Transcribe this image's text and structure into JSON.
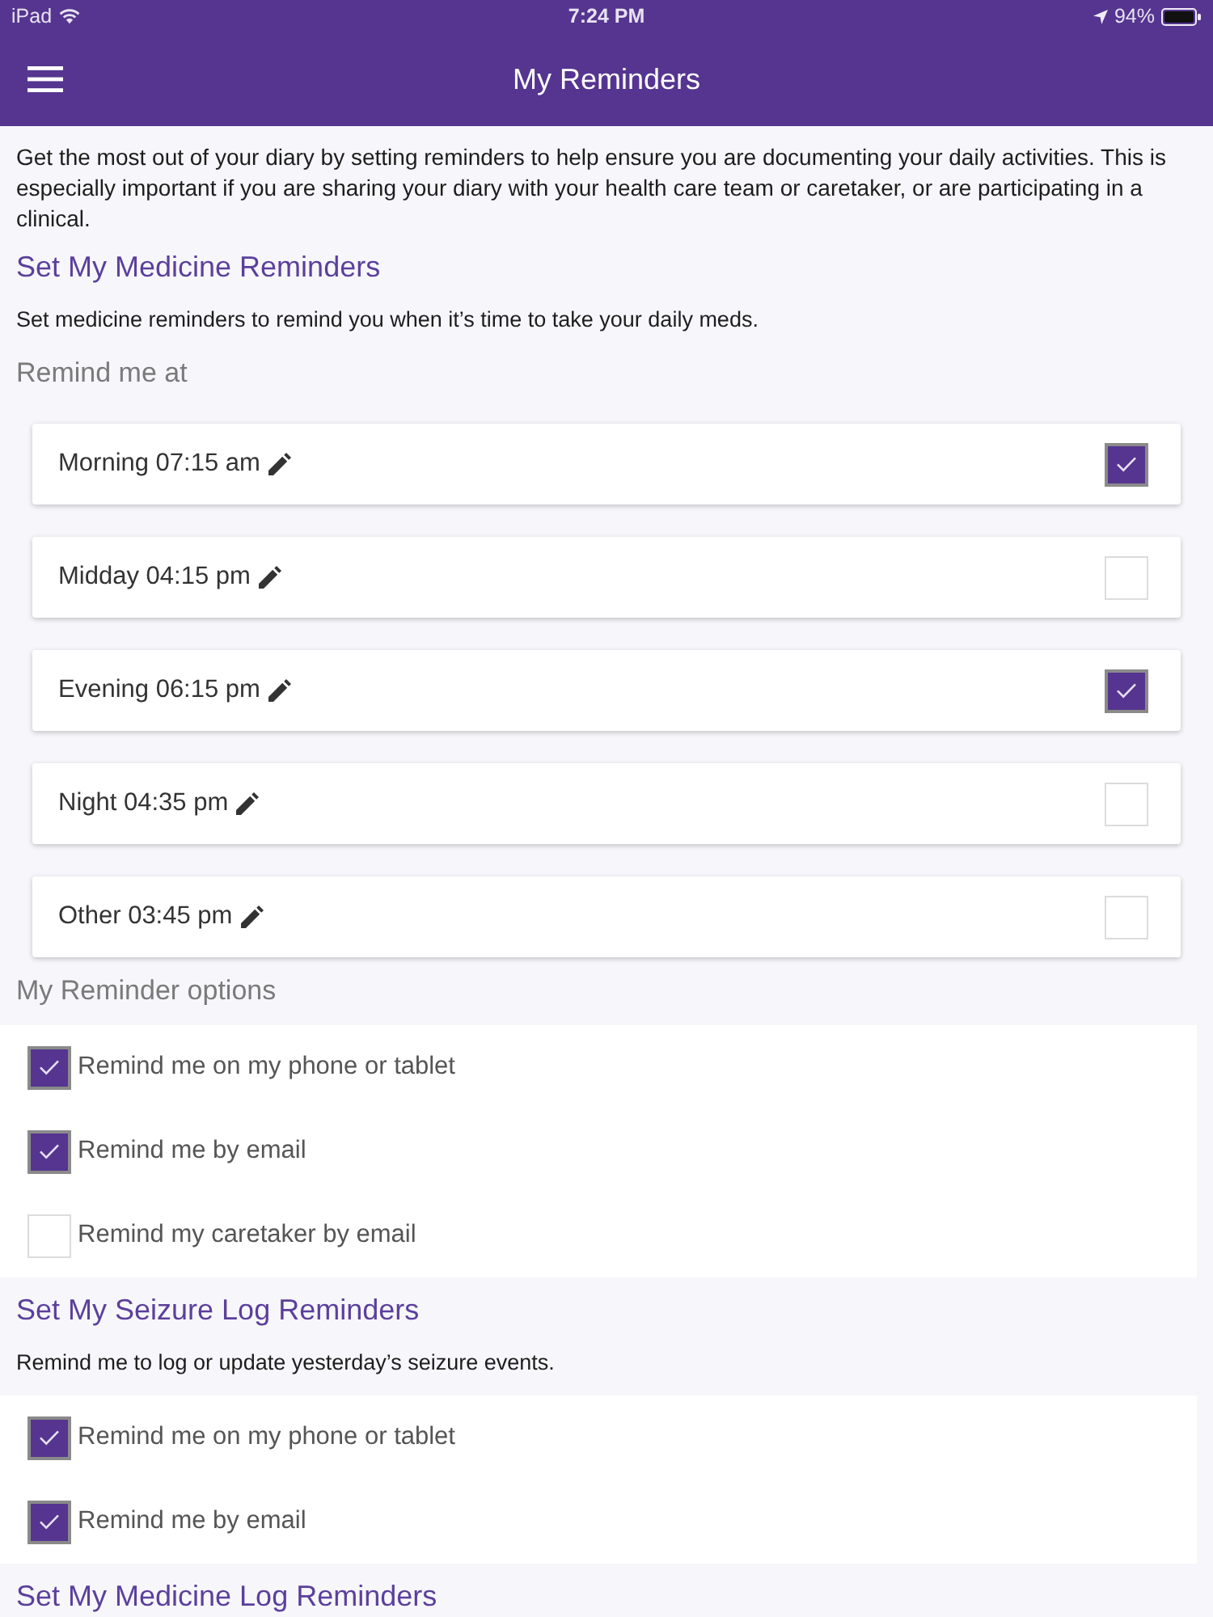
{
  "status_bar": {
    "device": "iPad",
    "time": "7:24 PM",
    "battery": "94%"
  },
  "app_bar": {
    "title": "My Reminders"
  },
  "intro": "Get the most out of your diary by setting reminders to help ensure you are documenting your daily activities. This is especially important if you are sharing your diary with your health care team or caretaker, or are participating in a clinical.",
  "sections": [
    {
      "heading": "Set My Medicine Reminders",
      "description": "Set medicine reminders to remind you when it’s time to take your daily meds.",
      "groups": [
        {
          "kind": "times",
          "label": "Remind me at",
          "items": [
            {
              "label": "Morning 07:15 am",
              "checked": true
            },
            {
              "label": "Midday 04:15 pm",
              "checked": false
            },
            {
              "label": "Evening 06:15 pm",
              "checked": true
            },
            {
              "label": "Night 04:35 pm",
              "checked": false
            },
            {
              "label": "Other 03:45 pm",
              "checked": false
            }
          ]
        },
        {
          "kind": "options",
          "label": "My Reminder options",
          "items": [
            {
              "label": "Remind me on my phone or tablet",
              "checked": true
            },
            {
              "label": "Remind me by email",
              "checked": true
            },
            {
              "label": "Remind my caretaker by email",
              "checked": false
            }
          ]
        }
      ]
    },
    {
      "heading": "Set My Seizure Log Reminders",
      "description": "Remind me to log or update yesterday’s seizure events.",
      "groups": [
        {
          "kind": "options",
          "items": [
            {
              "label": "Remind me on my phone or tablet",
              "checked": true
            },
            {
              "label": "Remind me by email",
              "checked": true
            }
          ]
        }
      ]
    },
    {
      "heading": "Set My Medicine Log Reminders"
    }
  ]
}
